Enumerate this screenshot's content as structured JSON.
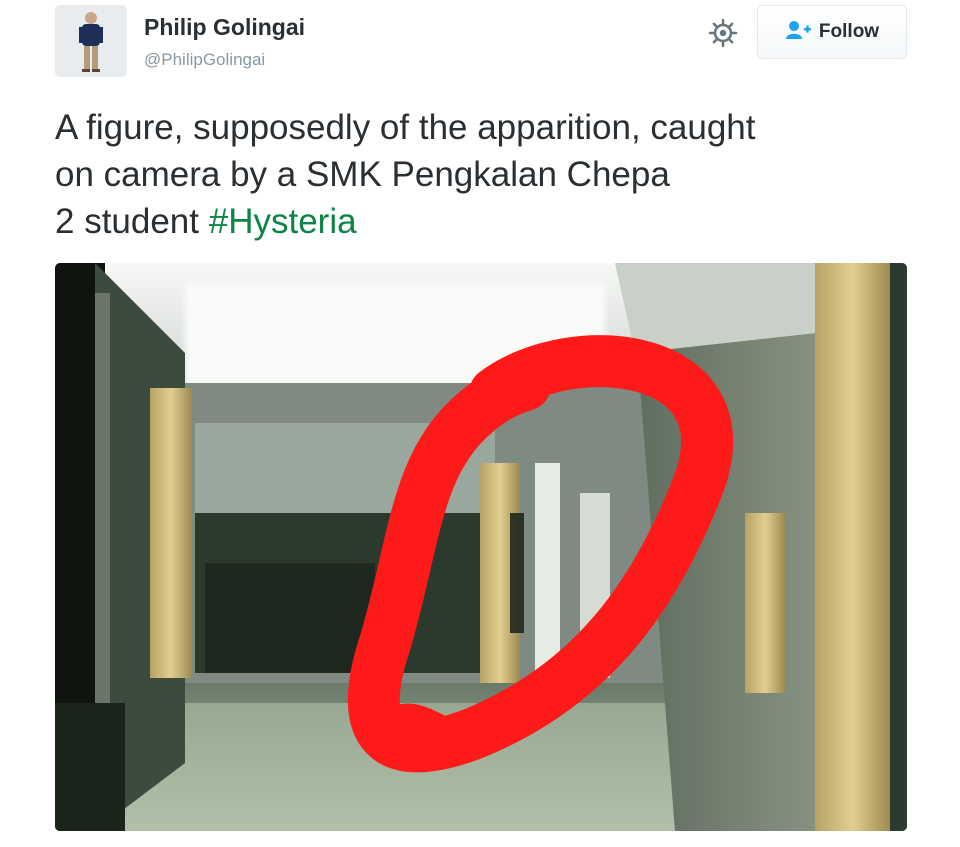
{
  "user": {
    "name": "Philip Golingai",
    "handle": "@PhilipGolingai"
  },
  "actions": {
    "settings_icon": "gear-icon",
    "follow_icon": "add-user-icon",
    "follow_label": "Follow"
  },
  "tweet": {
    "line1": "A figure, supposedly of the apparition, caught",
    "line2": "on camera by a SMK Pengkalan Chepa",
    "line3_prefix": "2 student ",
    "hashtag": "#Hysteria"
  },
  "colors": {
    "hashtag": "#0a8545",
    "follow_icon": "#1da1f2",
    "circle_marker": "#ff1a1a"
  }
}
